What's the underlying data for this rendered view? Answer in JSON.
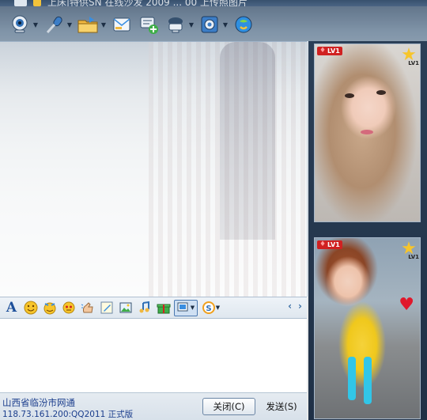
{
  "titlebar": {
    "text": "上床|特供SN  在线沙发  2009 ... 00 上传照图片"
  },
  "toolbar": {
    "buttons": [
      {
        "name": "video-call",
        "icon": "webcam-icon",
        "has_caret": true
      },
      {
        "name": "voice-call",
        "icon": "microphone-icon",
        "has_caret": true
      },
      {
        "name": "send-file",
        "icon": "folder-icon",
        "has_caret": true
      },
      {
        "name": "send-sms",
        "icon": "envelope-icon",
        "has_caret": false
      },
      {
        "name": "create-group",
        "icon": "add-discussion-icon",
        "has_caret": false
      },
      {
        "name": "remote-assist",
        "icon": "remote-icon",
        "has_caret": true
      },
      {
        "name": "apps",
        "icon": "gear-icon",
        "has_caret": true
      },
      {
        "name": "qq-music",
        "icon": "qq-icon",
        "has_caret": false
      }
    ]
  },
  "format_bar": {
    "font_label": "A",
    "tools": [
      "smile-icon",
      "magic-face-icon",
      "face-effect-icon",
      "shake-window-icon",
      "handwriting-icon",
      "image-icon",
      "music-icon",
      "gift-icon",
      "screenshot-icon",
      "payment-icon"
    ],
    "nav_prev": "‹",
    "nav_next": "›"
  },
  "bottom": {
    "location": "山西省临汾市网通",
    "ip_line": "118.73.161.200:QQ2011  正式版",
    "close_label": "关闭(C)",
    "send_label": "发送(S)"
  },
  "cams": [
    {
      "level": "LV1",
      "star_level": "LV1"
    },
    {
      "level": "LV1",
      "star_level": "LV1"
    }
  ],
  "colors": {
    "accent": "#1a3d8c",
    "badge": "#d02121",
    "star": "#f7c52b"
  }
}
